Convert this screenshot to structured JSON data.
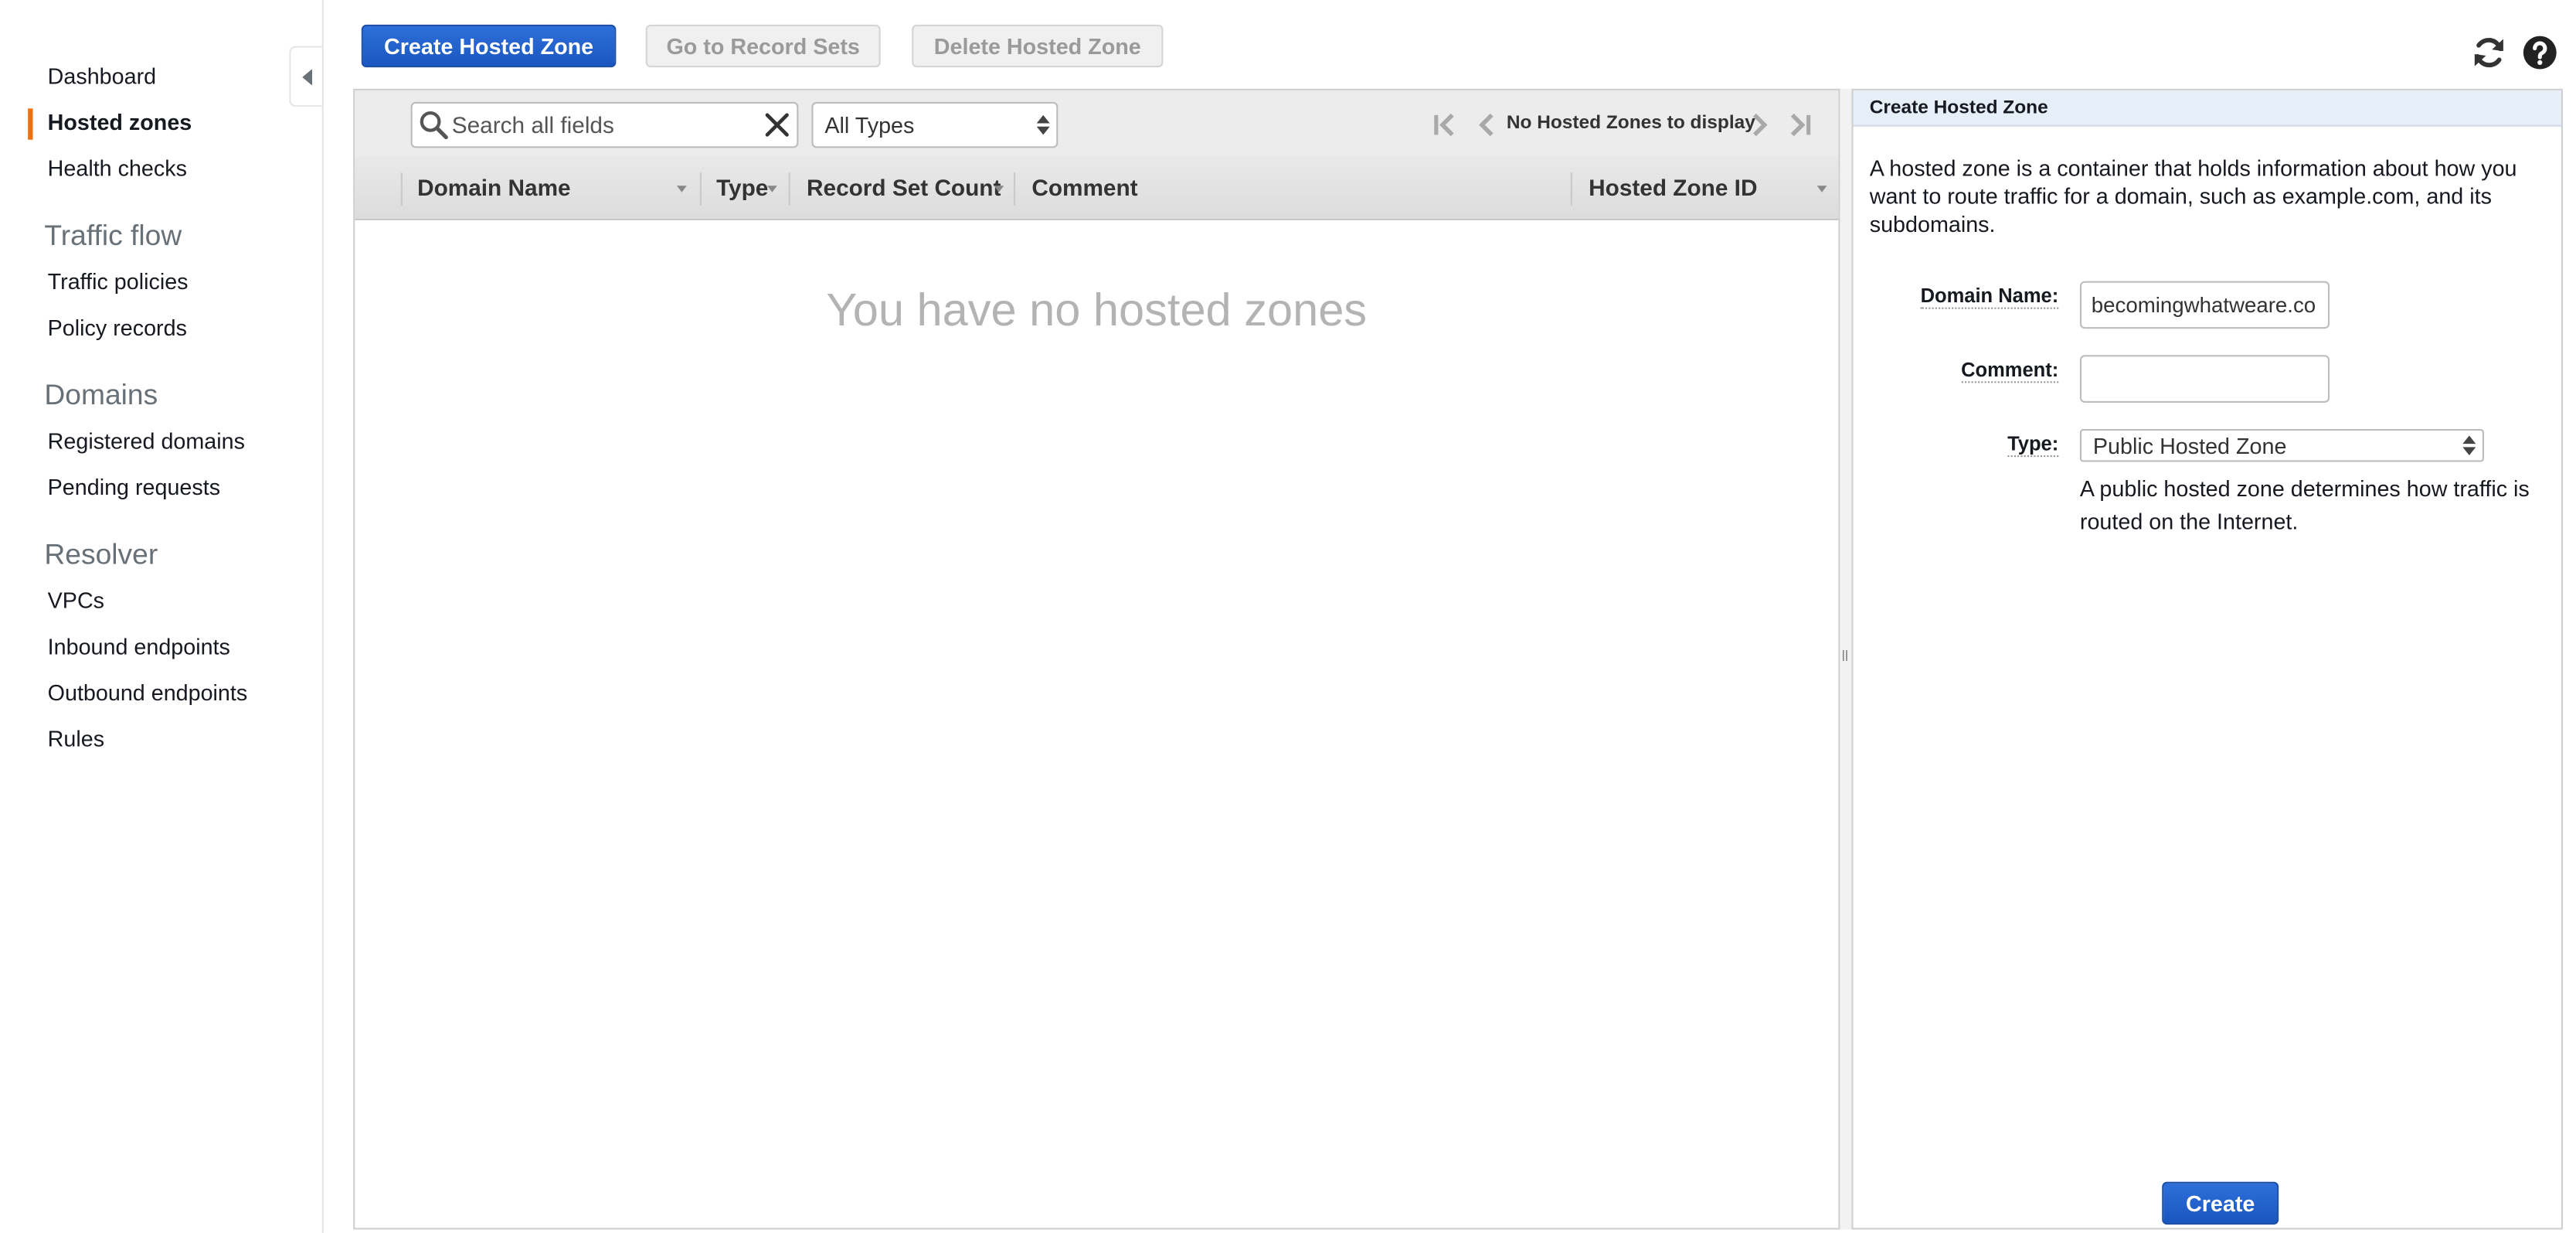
{
  "sidebar": {
    "items_top": [
      {
        "label": "Dashboard"
      },
      {
        "label": "Hosted zones"
      },
      {
        "label": "Health checks"
      }
    ],
    "active_item": "Hosted zones",
    "active_color": "#ec7211",
    "sections": [
      {
        "title": "Traffic flow",
        "items": [
          "Traffic policies",
          "Policy records"
        ]
      },
      {
        "title": "Domains",
        "items": [
          "Registered domains",
          "Pending requests"
        ]
      },
      {
        "title": "Resolver",
        "items": [
          "VPCs",
          "Inbound endpoints",
          "Outbound endpoints",
          "Rules"
        ]
      }
    ],
    "collapse_icon": "collapse-left-icon"
  },
  "toolbar": {
    "create_label": "Create Hosted Zone",
    "records_label": "Go to Record Sets",
    "delete_label": "Delete Hosted Zone",
    "refresh_icon": "refresh-icon",
    "help_icon": "help-icon"
  },
  "filter": {
    "search_placeholder": "Search all fields",
    "search_value": "",
    "type_selected": "All Types",
    "pager_text": "No Hosted Zones to display"
  },
  "table": {
    "columns": [
      "Domain Name",
      "Type",
      "Record Set Count",
      "Comment",
      "Hosted Zone ID"
    ],
    "rows": [],
    "empty_message": "You have no hosted zones"
  },
  "form": {
    "header": "Create Hosted Zone",
    "description": "A hosted zone is a container that holds information about how you want to route traffic for a domain, such as example.com, and its subdomains.",
    "domain_label": "Domain Name:",
    "domain_value": "becomingwhatweare.co",
    "comment_label": "Comment:",
    "comment_value": "",
    "type_label": "Type:",
    "type_selected": "Public Hosted Zone",
    "type_hint": "A public hosted zone determines how traffic is routed on the Internet.",
    "create_label": "Create"
  },
  "colors": {
    "primary_button": "#1a56c0",
    "right_header_bg": "#e6eef8"
  }
}
